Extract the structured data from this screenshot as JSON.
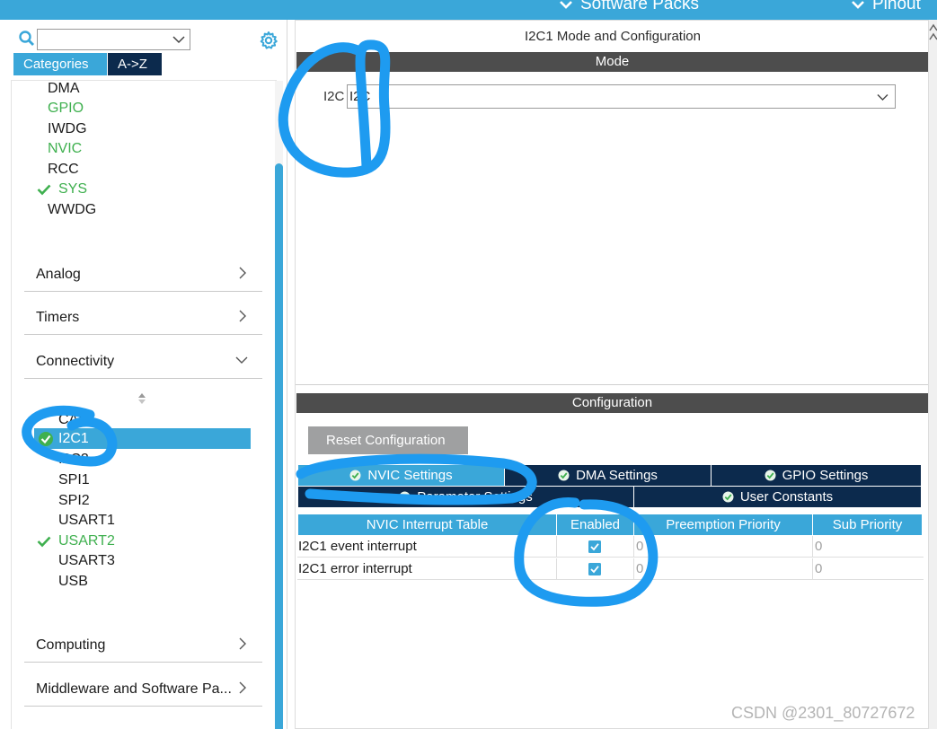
{
  "topbar": {
    "software_packs_label": "Software Packs",
    "pinout_label": "Pinout"
  },
  "left_panel": {
    "search": {
      "value": "",
      "placeholder": ""
    },
    "tabs": [
      {
        "label": "Categories",
        "active": true
      },
      {
        "label": "A->Z",
        "active": false
      }
    ],
    "system_core_items": [
      {
        "label": "DMA",
        "state": "normal"
      },
      {
        "label": "GPIO",
        "state": "green"
      },
      {
        "label": "IWDG",
        "state": "normal"
      },
      {
        "label": "NVIC",
        "state": "green"
      },
      {
        "label": "RCC",
        "state": "normal"
      },
      {
        "label": "SYS",
        "state": "checked"
      },
      {
        "label": "WWDG",
        "state": "normal"
      }
    ],
    "categories": [
      {
        "label": "Analog",
        "expanded": false
      },
      {
        "label": "Timers",
        "expanded": false
      },
      {
        "label": "Connectivity",
        "expanded": true
      },
      {
        "label": "Computing",
        "expanded": false
      },
      {
        "label": "Middleware and Software Pa...",
        "expanded": false
      }
    ],
    "connectivity_items": [
      {
        "label": "CAN",
        "state": "normal"
      },
      {
        "label": "I2C1",
        "state": "selected-checked"
      },
      {
        "label": "I2C2",
        "state": "normal"
      },
      {
        "label": "SPI1",
        "state": "normal"
      },
      {
        "label": "SPI2",
        "state": "normal"
      },
      {
        "label": "USART1",
        "state": "normal"
      },
      {
        "label": "USART2",
        "state": "checked"
      },
      {
        "label": "USART3",
        "state": "normal"
      },
      {
        "label": "USB",
        "state": "normal"
      }
    ]
  },
  "right_panel": {
    "title": "I2C1 Mode and Configuration",
    "mode_section": "Mode",
    "mode_field": {
      "label": "I2C",
      "value": "I2C"
    },
    "config_section": "Configuration",
    "reset_button": "Reset Configuration",
    "config_tabs": [
      {
        "label": "NVIC Settings",
        "active": true
      },
      {
        "label": "DMA Settings",
        "active": false
      },
      {
        "label": "GPIO Settings",
        "active": false
      },
      {
        "label": "Parameter Settings",
        "active": false
      },
      {
        "label": "User Constants",
        "active": false
      }
    ],
    "nvic_table": {
      "headers": [
        "NVIC Interrupt Table",
        "Enabled",
        "Preemption Priority",
        "Sub Priority"
      ],
      "rows": [
        {
          "name": "I2C1 event interrupt",
          "enabled": true,
          "preemption": "0",
          "sub": "0"
        },
        {
          "name": "I2C1 error interrupt",
          "enabled": true,
          "preemption": "0",
          "sub": "0"
        }
      ]
    }
  },
  "watermark": "CSDN @2301_80727672",
  "colors": {
    "accent": "#3aa7d9",
    "navy": "#0c2a4d",
    "section_bar": "#4d4d4d",
    "ok_green": "#3fb04f",
    "annotation_blue": "#1e9bf0"
  }
}
